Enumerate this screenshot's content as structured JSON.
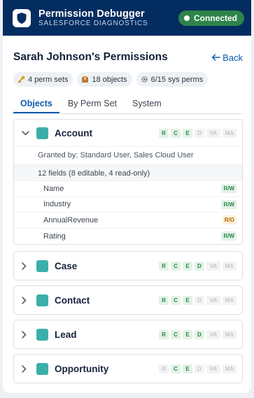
{
  "header": {
    "title": "Permission Debugger",
    "subtitle": "SALESFORCE DIAGNOSTICS",
    "status": "Connected",
    "colors": {
      "header_bg": "#032d60",
      "status_bg": "#2e844a"
    }
  },
  "user": {
    "title": "Sarah Johnson's Permissions",
    "back_label": "Back"
  },
  "summary": [
    {
      "icon": "key-icon",
      "label": "4 perm sets"
    },
    {
      "icon": "box-icon",
      "label": "18 objects"
    },
    {
      "icon": "gear-icon",
      "label": "6/15 sys perms"
    }
  ],
  "tabs": [
    {
      "label": "Objects",
      "active": true
    },
    {
      "label": "By Perm Set",
      "active": false
    },
    {
      "label": "System",
      "active": false
    }
  ],
  "objects": [
    {
      "name": "Account",
      "expanded": true,
      "perms": [
        {
          "label": "R",
          "on": true
        },
        {
          "label": "C",
          "on": true
        },
        {
          "label": "E",
          "on": true
        },
        {
          "label": "D",
          "on": false
        },
        {
          "label": "VA",
          "on": false
        },
        {
          "label": "MA",
          "on": false
        }
      ],
      "granted_by": "Granted by: Standard User, Sales Cloud User",
      "field_summary": "12 fields (8 editable, 4 read-only)",
      "fields": [
        {
          "name": "Name",
          "access": "R/W"
        },
        {
          "name": "Industry",
          "access": "R/W"
        },
        {
          "name": "AnnualRevenue",
          "access": "R/O"
        },
        {
          "name": "Rating",
          "access": "R/W"
        }
      ]
    },
    {
      "name": "Case",
      "expanded": false,
      "perms": [
        {
          "label": "R",
          "on": true
        },
        {
          "label": "C",
          "on": true
        },
        {
          "label": "E",
          "on": true
        },
        {
          "label": "D",
          "on": true
        },
        {
          "label": "VA",
          "on": false
        },
        {
          "label": "MA",
          "on": false
        }
      ]
    },
    {
      "name": "Contact",
      "expanded": false,
      "perms": [
        {
          "label": "R",
          "on": true
        },
        {
          "label": "C",
          "on": true
        },
        {
          "label": "E",
          "on": true
        },
        {
          "label": "D",
          "on": false
        },
        {
          "label": "VA",
          "on": false
        },
        {
          "label": "MA",
          "on": false
        }
      ]
    },
    {
      "name": "Lead",
      "expanded": false,
      "perms": [
        {
          "label": "R",
          "on": true
        },
        {
          "label": "C",
          "on": true
        },
        {
          "label": "E",
          "on": true
        },
        {
          "label": "D",
          "on": true
        },
        {
          "label": "VA",
          "on": false
        },
        {
          "label": "MA",
          "on": false
        }
      ]
    },
    {
      "name": "Opportunity",
      "expanded": false,
      "perms": [
        {
          "label": "R",
          "on": false
        },
        {
          "label": "C",
          "on": true
        },
        {
          "label": "E",
          "on": true
        },
        {
          "label": "D",
          "on": false
        },
        {
          "label": "VA",
          "on": false
        },
        {
          "label": "MA",
          "on": false
        }
      ]
    }
  ]
}
